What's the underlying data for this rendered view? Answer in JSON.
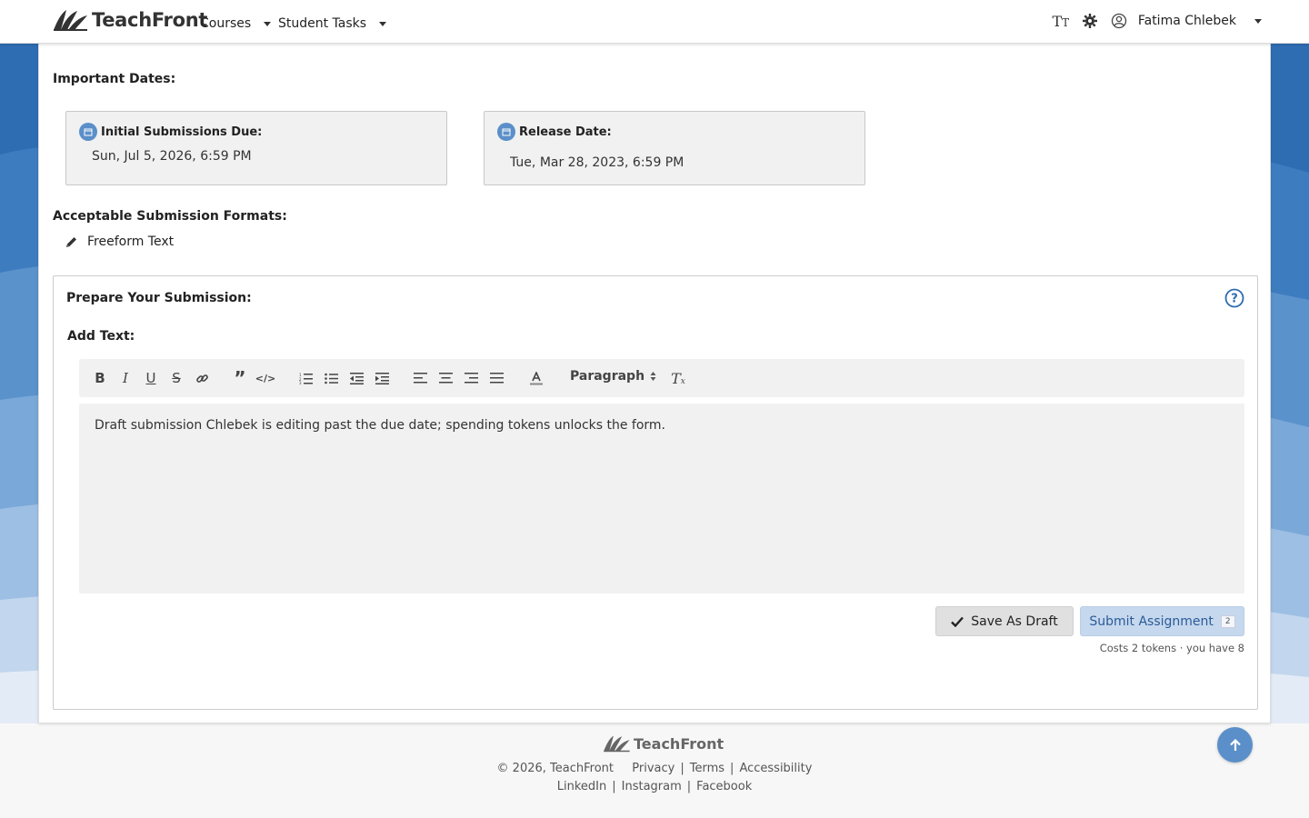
{
  "brand": {
    "name": "TeachFront"
  },
  "nav": {
    "courses": "Courses",
    "student_tasks": "Student Tasks",
    "user_name": "Fatima Chlebek",
    "icons": [
      "text-size-icon",
      "theme-gear-icon",
      "user-avatar-icon"
    ]
  },
  "important_dates": {
    "heading": "Important Dates:",
    "initial_due_label": "Initial Submissions Due:",
    "initial_due_value": "Sun, Jul 5, 2026, 6:59 PM",
    "release_label": "Release Date:",
    "release_value": "Tue, Mar 28, 2023, 6:59 PM"
  },
  "formats": {
    "heading": "Acceptable Submission Formats:",
    "items": [
      "Freeform Text"
    ]
  },
  "submission": {
    "heading": "Prepare Your Submission:",
    "add_text_label": "Add Text:",
    "paragraph_select": "Paragraph",
    "editor_text": "Draft submission Chlebek is editing past the due date; spending tokens unlocks the form.",
    "save_draft_label": "Save As Draft",
    "submit_label": "Submit Assignment",
    "token_badge": "2",
    "cost_note": "Costs 2 tokens · you have 8"
  },
  "footer": {
    "brand": "TeachFront",
    "copyright": "© 2026, TeachFront",
    "links_row1": [
      "Privacy",
      "Terms",
      "Accessibility"
    ],
    "links_row2": [
      "LinkedIn",
      "Instagram",
      "Facebook"
    ]
  },
  "colors": {
    "accent": "#5b8fc9",
    "submit_bg": "#c6d8ee",
    "submit_text": "#2b5b96",
    "wave_dark": "#2f6db3",
    "wave_light": "#dfe8f4"
  }
}
